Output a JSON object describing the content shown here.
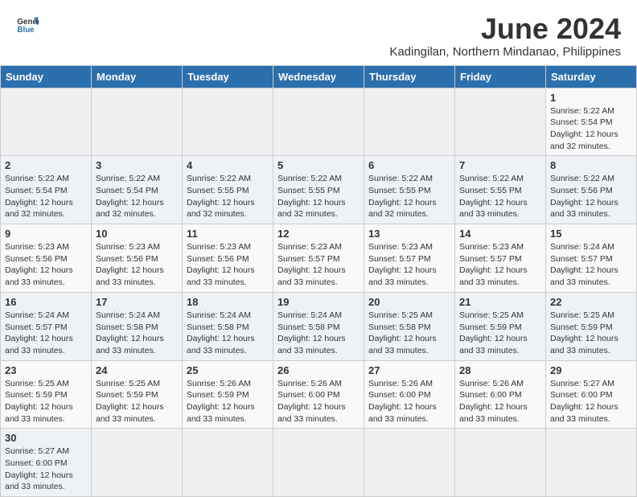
{
  "header": {
    "logo_general": "General",
    "logo_blue": "Blue",
    "month_title": "June 2024",
    "subtitle": "Kadingilan, Northern Mindanao, Philippines"
  },
  "days_of_week": [
    "Sunday",
    "Monday",
    "Tuesday",
    "Wednesday",
    "Thursday",
    "Friday",
    "Saturday"
  ],
  "weeks": [
    [
      {
        "day": "",
        "sunrise": "",
        "sunset": "",
        "daylight": ""
      },
      {
        "day": "",
        "sunrise": "",
        "sunset": "",
        "daylight": ""
      },
      {
        "day": "",
        "sunrise": "",
        "sunset": "",
        "daylight": ""
      },
      {
        "day": "",
        "sunrise": "",
        "sunset": "",
        "daylight": ""
      },
      {
        "day": "",
        "sunrise": "",
        "sunset": "",
        "daylight": ""
      },
      {
        "day": "",
        "sunrise": "",
        "sunset": "",
        "daylight": ""
      },
      {
        "day": "1",
        "sunrise": "Sunrise: 5:22 AM",
        "sunset": "Sunset: 5:54 PM",
        "daylight": "Daylight: 12 hours and 32 minutes."
      }
    ],
    [
      {
        "day": "2",
        "sunrise": "Sunrise: 5:22 AM",
        "sunset": "Sunset: 5:54 PM",
        "daylight": "Daylight: 12 hours and 32 minutes."
      },
      {
        "day": "3",
        "sunrise": "Sunrise: 5:22 AM",
        "sunset": "Sunset: 5:54 PM",
        "daylight": "Daylight: 12 hours and 32 minutes."
      },
      {
        "day": "4",
        "sunrise": "Sunrise: 5:22 AM",
        "sunset": "Sunset: 5:55 PM",
        "daylight": "Daylight: 12 hours and 32 minutes."
      },
      {
        "day": "5",
        "sunrise": "Sunrise: 5:22 AM",
        "sunset": "Sunset: 5:55 PM",
        "daylight": "Daylight: 12 hours and 32 minutes."
      },
      {
        "day": "6",
        "sunrise": "Sunrise: 5:22 AM",
        "sunset": "Sunset: 5:55 PM",
        "daylight": "Daylight: 12 hours and 32 minutes."
      },
      {
        "day": "7",
        "sunrise": "Sunrise: 5:22 AM",
        "sunset": "Sunset: 5:55 PM",
        "daylight": "Daylight: 12 hours and 33 minutes."
      },
      {
        "day": "8",
        "sunrise": "Sunrise: 5:22 AM",
        "sunset": "Sunset: 5:56 PM",
        "daylight": "Daylight: 12 hours and 33 minutes."
      }
    ],
    [
      {
        "day": "9",
        "sunrise": "Sunrise: 5:23 AM",
        "sunset": "Sunset: 5:56 PM",
        "daylight": "Daylight: 12 hours and 33 minutes."
      },
      {
        "day": "10",
        "sunrise": "Sunrise: 5:23 AM",
        "sunset": "Sunset: 5:56 PM",
        "daylight": "Daylight: 12 hours and 33 minutes."
      },
      {
        "day": "11",
        "sunrise": "Sunrise: 5:23 AM",
        "sunset": "Sunset: 5:56 PM",
        "daylight": "Daylight: 12 hours and 33 minutes."
      },
      {
        "day": "12",
        "sunrise": "Sunrise: 5:23 AM",
        "sunset": "Sunset: 5:57 PM",
        "daylight": "Daylight: 12 hours and 33 minutes."
      },
      {
        "day": "13",
        "sunrise": "Sunrise: 5:23 AM",
        "sunset": "Sunset: 5:57 PM",
        "daylight": "Daylight: 12 hours and 33 minutes."
      },
      {
        "day": "14",
        "sunrise": "Sunrise: 5:23 AM",
        "sunset": "Sunset: 5:57 PM",
        "daylight": "Daylight: 12 hours and 33 minutes."
      },
      {
        "day": "15",
        "sunrise": "Sunrise: 5:24 AM",
        "sunset": "Sunset: 5:57 PM",
        "daylight": "Daylight: 12 hours and 33 minutes."
      }
    ],
    [
      {
        "day": "16",
        "sunrise": "Sunrise: 5:24 AM",
        "sunset": "Sunset: 5:57 PM",
        "daylight": "Daylight: 12 hours and 33 minutes."
      },
      {
        "day": "17",
        "sunrise": "Sunrise: 5:24 AM",
        "sunset": "Sunset: 5:58 PM",
        "daylight": "Daylight: 12 hours and 33 minutes."
      },
      {
        "day": "18",
        "sunrise": "Sunrise: 5:24 AM",
        "sunset": "Sunset: 5:58 PM",
        "daylight": "Daylight: 12 hours and 33 minutes."
      },
      {
        "day": "19",
        "sunrise": "Sunrise: 5:24 AM",
        "sunset": "Sunset: 5:58 PM",
        "daylight": "Daylight: 12 hours and 33 minutes."
      },
      {
        "day": "20",
        "sunrise": "Sunrise: 5:25 AM",
        "sunset": "Sunset: 5:58 PM",
        "daylight": "Daylight: 12 hours and 33 minutes."
      },
      {
        "day": "21",
        "sunrise": "Sunrise: 5:25 AM",
        "sunset": "Sunset: 5:59 PM",
        "daylight": "Daylight: 12 hours and 33 minutes."
      },
      {
        "day": "22",
        "sunrise": "Sunrise: 5:25 AM",
        "sunset": "Sunset: 5:59 PM",
        "daylight": "Daylight: 12 hours and 33 minutes."
      }
    ],
    [
      {
        "day": "23",
        "sunrise": "Sunrise: 5:25 AM",
        "sunset": "Sunset: 5:59 PM",
        "daylight": "Daylight: 12 hours and 33 minutes."
      },
      {
        "day": "24",
        "sunrise": "Sunrise: 5:25 AM",
        "sunset": "Sunset: 5:59 PM",
        "daylight": "Daylight: 12 hours and 33 minutes."
      },
      {
        "day": "25",
        "sunrise": "Sunrise: 5:26 AM",
        "sunset": "Sunset: 5:59 PM",
        "daylight": "Daylight: 12 hours and 33 minutes."
      },
      {
        "day": "26",
        "sunrise": "Sunrise: 5:26 AM",
        "sunset": "Sunset: 6:00 PM",
        "daylight": "Daylight: 12 hours and 33 minutes."
      },
      {
        "day": "27",
        "sunrise": "Sunrise: 5:26 AM",
        "sunset": "Sunset: 6:00 PM",
        "daylight": "Daylight: 12 hours and 33 minutes."
      },
      {
        "day": "28",
        "sunrise": "Sunrise: 5:26 AM",
        "sunset": "Sunset: 6:00 PM",
        "daylight": "Daylight: 12 hours and 33 minutes."
      },
      {
        "day": "29",
        "sunrise": "Sunrise: 5:27 AM",
        "sunset": "Sunset: 6:00 PM",
        "daylight": "Daylight: 12 hours and 33 minutes."
      }
    ],
    [
      {
        "day": "30",
        "sunrise": "Sunrise: 5:27 AM",
        "sunset": "Sunset: 6:00 PM",
        "daylight": "Daylight: 12 hours and 33 minutes."
      },
      {
        "day": "",
        "sunrise": "",
        "sunset": "",
        "daylight": ""
      },
      {
        "day": "",
        "sunrise": "",
        "sunset": "",
        "daylight": ""
      },
      {
        "day": "",
        "sunrise": "",
        "sunset": "",
        "daylight": ""
      },
      {
        "day": "",
        "sunrise": "",
        "sunset": "",
        "daylight": ""
      },
      {
        "day": "",
        "sunrise": "",
        "sunset": "",
        "daylight": ""
      },
      {
        "day": "",
        "sunrise": "",
        "sunset": "",
        "daylight": ""
      }
    ]
  ]
}
